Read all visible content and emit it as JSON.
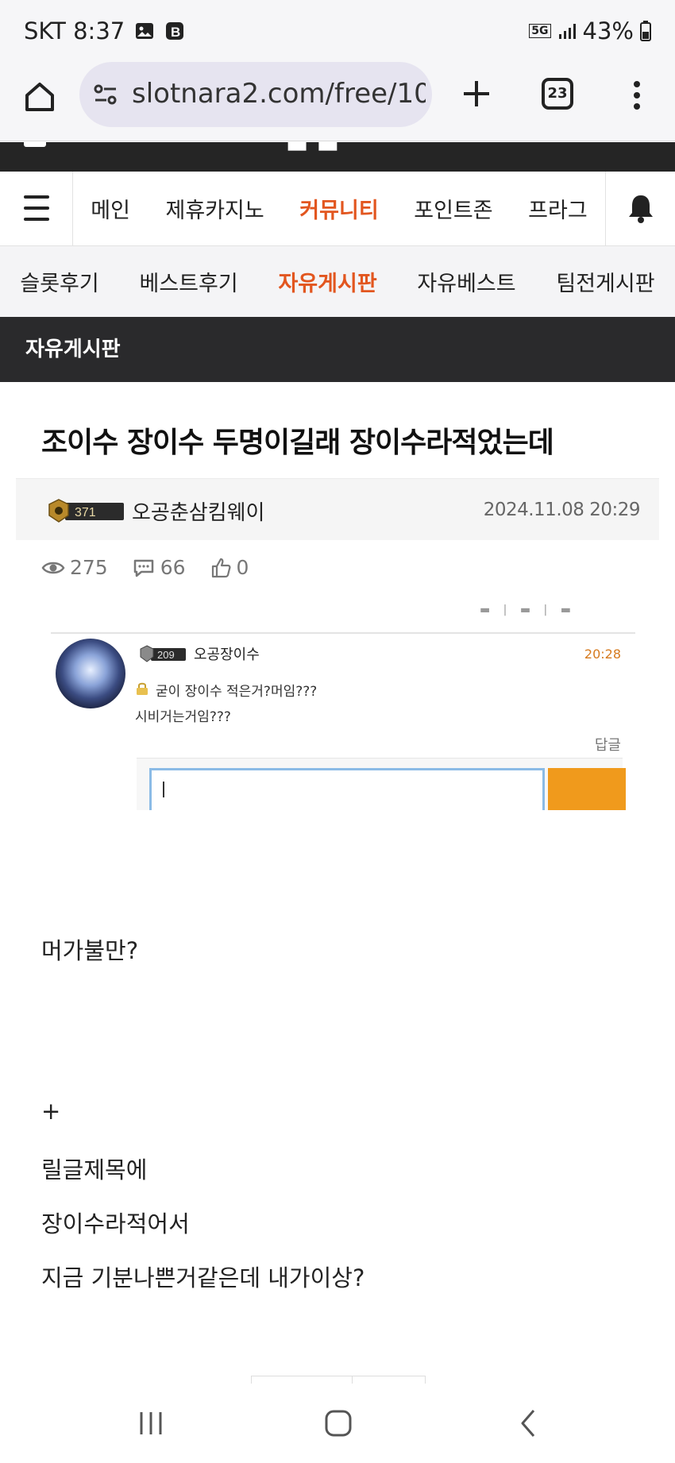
{
  "status_bar": {
    "carrier_time": "SKT 8:37",
    "network": "5G",
    "battery": "43%"
  },
  "browser": {
    "url": "slotnara2.com/free/10",
    "tab_count": "23"
  },
  "main_nav": {
    "items": [
      "메인",
      "제휴카지노",
      "커뮤니티",
      "포인트존",
      "프라그"
    ],
    "active_index": 2
  },
  "sub_nav": {
    "items": [
      "슬롯후기",
      "베스트후기",
      "자유게시판",
      "자유베스트",
      "팀전게시판"
    ],
    "active_index": 2
  },
  "board": {
    "title": "자유게시판"
  },
  "post": {
    "title": "조이수 장이수 두명이길래 장이수라적었는데",
    "author": {
      "level": "371",
      "name": "오공춘삼킴웨이"
    },
    "date": "2024.11.08 20:29",
    "stats": {
      "views": "275",
      "comments": "66",
      "likes": "0"
    },
    "embedded_comment": {
      "level": "209",
      "name": "오공장이수",
      "time": "20:28",
      "line1": "굳이 장이수 적은거?머임???",
      "line2": "시비거는거임???",
      "reply_label": "답글"
    },
    "body": [
      "머가불만?",
      "+",
      "릴글제목에",
      "장이수라적어서",
      "지금 기분나쁜거같은데 내가이상?"
    ]
  },
  "colors": {
    "accent": "#e2561f",
    "dark_bar": "#2a2a2c",
    "submit": "#f09a1c"
  }
}
